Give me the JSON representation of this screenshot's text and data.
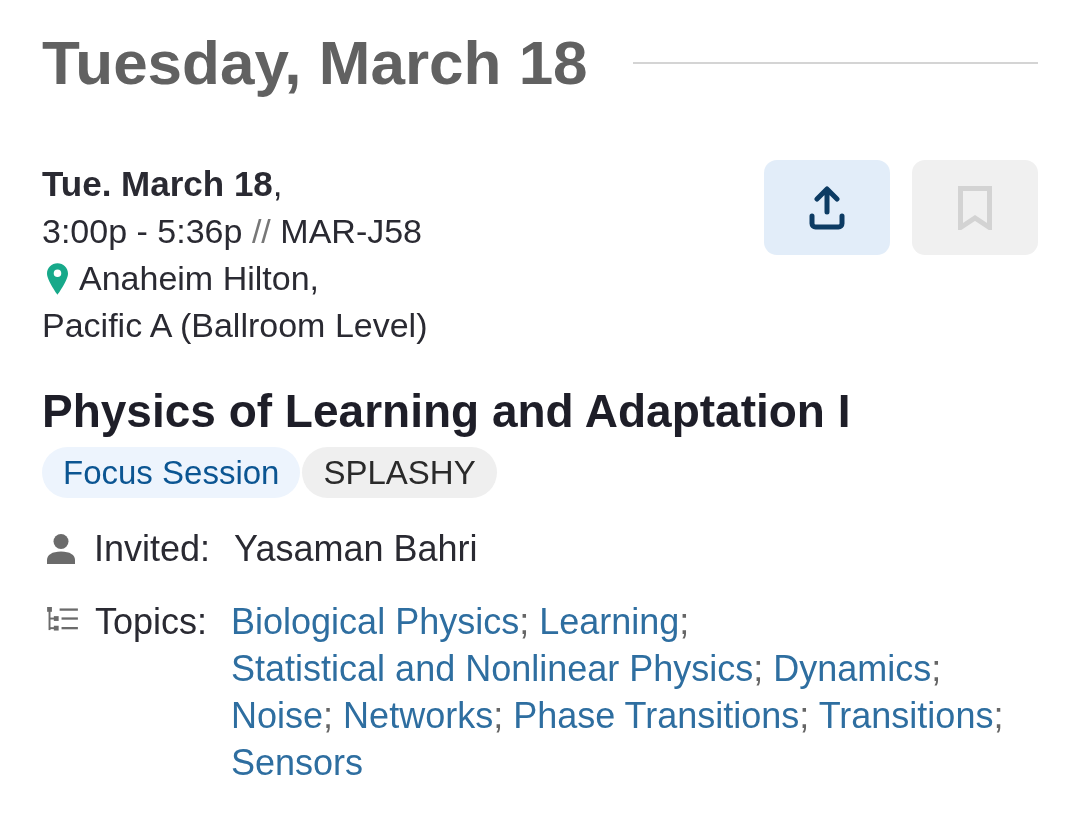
{
  "day_heading": {
    "title": "Tuesday, March 18"
  },
  "session": {
    "date": "**Tue. March 18**,",
    "time": "3:00p - 5:36p",
    "time_separator": "//",
    "code": "MAR-J58",
    "location": {
      "venue": "Anaheim Hilton,",
      "room": "Pacific A (Ballroom Level)"
    },
    "actions": [
      {
        "kind": "share",
        "disabled": false
      },
      {
        "kind": "bookmark",
        "disabled": true
      }
    ],
    "title": "Physics of Learning and Adaptation I",
    "tags": [
      {
        "label": "Focus Session",
        "kind": "session-type"
      },
      {
        "label": "SPLASHY",
        "kind": "label"
      }
    ],
    "invited": {
      "label": "Invited:",
      "speaker": "Yasaman Bahri"
    },
    "topics": {
      "label": "Topics:",
      "separator": ";",
      "items": [
        "Biological Physics",
        "Learning",
        "Statistical and Nonlinear Physics",
        "Dynamics",
        "Noise",
        "Networks",
        "Phase Transitions",
        "Transitions",
        "Sensors"
      ]
    }
  }
}
